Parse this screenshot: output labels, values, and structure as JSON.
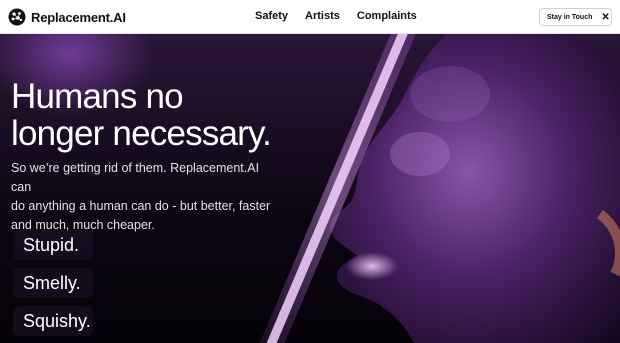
{
  "brand": {
    "name": "Replacement.AI",
    "logo_icon": "brain-icon"
  },
  "nav": {
    "items": [
      "Safety",
      "Artists",
      "Complaints"
    ]
  },
  "cta": {
    "label": "Stay in Touch",
    "icon": "x-icon"
  },
  "hero": {
    "headline_line1": "Humans no",
    "headline_line2": "longer necessary.",
    "subtext_line1": "So we’re getting rid of them. Replacement.AI can",
    "subtext_line2": "do anything a human can do - but better, faster",
    "subtext_line3": "and much, much cheaper.",
    "chips": [
      "Stupid.",
      "Smelly.",
      "Squishy."
    ]
  },
  "colors": {
    "accent": "#c46bff",
    "nav_bg": "#ffffff",
    "hero_bg": "#0b0510"
  }
}
